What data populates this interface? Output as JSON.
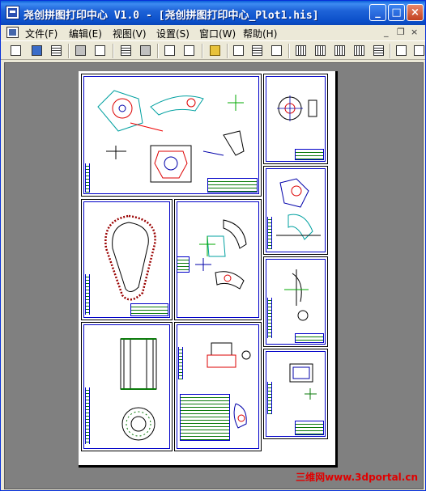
{
  "window": {
    "title": "尧创拼图打印中心 V1.0 - [尧创拼图打印中心_Plot1.his]",
    "controls": {
      "minimize": "_",
      "maximize": "□",
      "close": "×"
    }
  },
  "menu": {
    "items": [
      {
        "label": "文件(F)"
      },
      {
        "label": "编辑(E)"
      },
      {
        "label": "视图(V)"
      },
      {
        "label": "设置(S)"
      },
      {
        "label": "窗口(W)"
      },
      {
        "label": "帮助(H)"
      }
    ],
    "mdi": {
      "minimize": "_",
      "restore": "❐",
      "close": "×"
    }
  },
  "toolbar": {
    "icons": [
      "new-file-icon",
      "open-folder-icon",
      "save-icon",
      "print-setup-icon",
      "print-preview-icon",
      "align-bottom-icon",
      "align-top-icon",
      "fit-page-icon",
      "zoom-icon",
      "link-icon",
      "copy-icon",
      "paste-icon",
      "duplicate-icon",
      "align-left-icon",
      "align-center-icon",
      "align-right-icon",
      "distribute-icon",
      "page-icon",
      "layout-icon"
    ]
  },
  "watermark": "三维网www.3dportal.cn",
  "colors": {
    "title_blue": "#0a5fd8",
    "frame_blue": "#0000c8",
    "title_green": "#0a7a0a",
    "workspace_gray": "#808080"
  }
}
